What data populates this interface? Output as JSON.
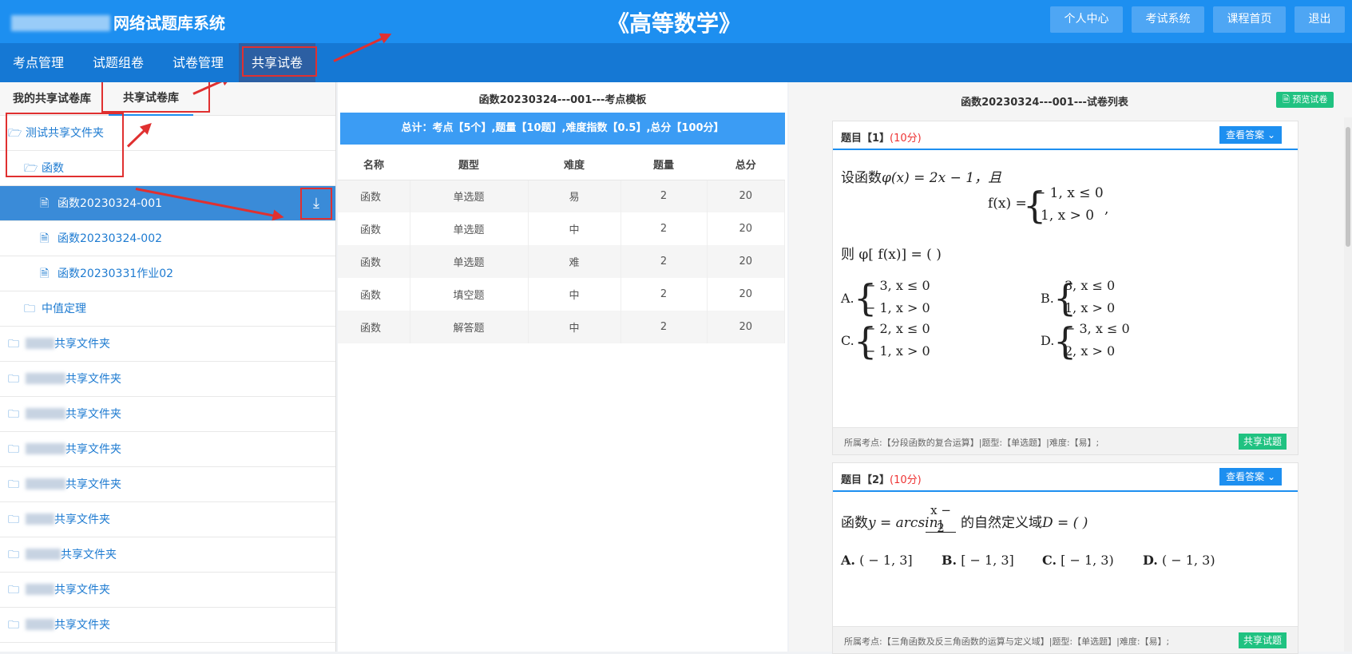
{
  "header": {
    "title_suffix": "网络试题库系统",
    "course_title": "《高等数学》",
    "buttons": [
      "个人中心",
      "考试系统",
      "课程首页",
      "退出"
    ]
  },
  "nav": {
    "items": [
      "考点管理",
      "试题组卷",
      "试卷管理",
      "共享试卷"
    ],
    "active": "共享试卷"
  },
  "left": {
    "tabs": [
      "我的共享试卷库",
      "共享试卷库"
    ],
    "active_tab": "共享试卷库",
    "tree": {
      "root_folder": "测试共享文件夹",
      "sub_folder": "函数",
      "files": [
        "函数20230324-001",
        "函数20230324-002",
        "函数20230331作业02"
      ],
      "other_subfolder": "中值定理",
      "shared_folder_suffix": "共享文件夹",
      "blurred_folder_count": 9
    }
  },
  "middle": {
    "title": "函数20230324---001---考点模板",
    "summary": "总计：考点【5个】,题量【10题】,难度指数【0.5】,总分【100分】",
    "columns": [
      "名称",
      "题型",
      "难度",
      "题量",
      "总分"
    ],
    "rows": [
      [
        "函数",
        "单选题",
        "易",
        "2",
        "20"
      ],
      [
        "函数",
        "单选题",
        "中",
        "2",
        "20"
      ],
      [
        "函数",
        "单选题",
        "难",
        "2",
        "20"
      ],
      [
        "函数",
        "填空题",
        "中",
        "2",
        "20"
      ],
      [
        "函数",
        "解答题",
        "中",
        "2",
        "20"
      ]
    ]
  },
  "right": {
    "title": "函数20230324---001---试卷列表",
    "preview_btn": "预览试卷",
    "questions": [
      {
        "title": "题目【1】",
        "score": "(10分)",
        "answer_btn": "查看答案",
        "stem_prefix": "设函数",
        "stem_expr": "φ(x) = 2x − 1，且",
        "f_def_lhs": "f(x) =",
        "f_case1": "− 1,    x ≤ 0",
        "f_case2": "1,    x > 0",
        "f_trail": ",",
        "ask": "则 φ[ f(x)] = (    )",
        "options": [
          {
            "label": "A.",
            "c1": "− 3,    x ≤ 0",
            "c2": "− 1,    x > 0"
          },
          {
            "label": "B.",
            "c1": "3,    x ≤ 0",
            "c2": "1,    x > 0"
          },
          {
            "label": "C.",
            "c1": "− 2,    x ≤ 0",
            "c2": "− 1,    x > 0"
          },
          {
            "label": "D.",
            "c1": "− 3,    x ≤ 0",
            "c2": "2,    x > 0"
          }
        ],
        "meta": "所属考点:【分段函数的复合运算】|题型:【单选题】|难度:【易】;",
        "share_btn": "共享试题"
      },
      {
        "title": "题目【2】",
        "score": "(10分)",
        "answer_btn": "查看答案",
        "stem_prefix": "函数",
        "stem_expr": "y = arcsin",
        "frac_num": "x − 1",
        "frac_den": "2",
        "stem_suffix": "的自然定义域",
        "stem_tail": "D = (    )",
        "options": [
          {
            "label": "A.",
            "text": "( − 1, 3]"
          },
          {
            "label": "B.",
            "text": "[ − 1, 3]"
          },
          {
            "label": "C.",
            "text": "[ − 1, 3)"
          },
          {
            "label": "D.",
            "text": "( − 1, 3)"
          }
        ],
        "meta": "所属考点:【三角函数及反三角函数的运算与定义域】|题型:【单选题】|难度:【易】;",
        "share_btn": "共享试题"
      }
    ]
  }
}
